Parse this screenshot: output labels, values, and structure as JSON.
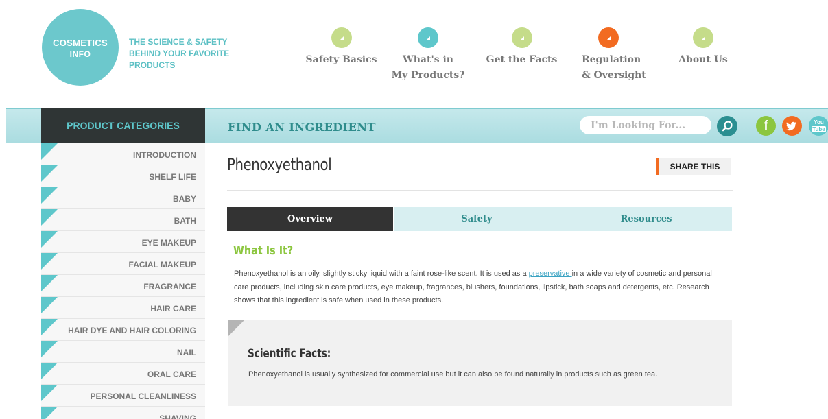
{
  "brand": {
    "logo_line1": "COSMETICS",
    "logo_line2": "INFO",
    "tagline": "THE SCIENCE & SAFETY BEHIND YOUR FAVORITE PRODUCTS",
    "accent": "#6cc8cc"
  },
  "nav": {
    "items": [
      {
        "line1": "Safety Basics",
        "line2": "",
        "color": "#c5dc8a"
      },
      {
        "line1": "What's in",
        "line2": "My Products?",
        "color": "#5ec7cb"
      },
      {
        "line1": "Get the Facts",
        "line2": "",
        "color": "#c5dc8a"
      },
      {
        "line1": "Regulation",
        "line2": "& Oversight",
        "color": "#f26b21"
      },
      {
        "line1": "About Us",
        "line2": "",
        "color": "#c5dc8a"
      }
    ]
  },
  "categories": {
    "header": "PRODUCT CATEGORIES",
    "items": [
      "INTRODUCTION",
      "SHELF LIFE",
      "BABY",
      "BATH",
      "EYE MAKEUP",
      "FACIAL MAKEUP",
      "FRAGRANCE",
      "HAIR CARE",
      "HAIR DYE AND HAIR COLORING",
      "NAIL",
      "ORAL CARE",
      "PERSONAL CLEANLINESS",
      "SHAVING"
    ]
  },
  "finder": {
    "title": "FIND AN INGREDIENT",
    "search_placeholder": "I'm Looking For...",
    "search_icon": "search-icon"
  },
  "social": {
    "icons": [
      "facebook-icon",
      "twitter-icon",
      "youtube-icon"
    ],
    "facebook_label": "f",
    "twitter_label": "t",
    "youtube_label_top": "You",
    "youtube_label_bottom": "Tube",
    "colors": {
      "facebook": "#8cc63f",
      "twitter": "#f26b21",
      "youtube": "#5ec7cb"
    }
  },
  "ingredient": {
    "name": "Phenoxyethanol",
    "share_label": "SHARE THIS",
    "tabs": [
      "Overview",
      "Safety",
      "Resources"
    ],
    "active_tab": "Overview",
    "what_is_heading": "What Is It?",
    "description_before_link": "Phenoxyethanol is an oily, slightly sticky liquid with a faint rose-like scent. It is used as a ",
    "description_link": "preservative ",
    "description_after_link": "in a wide variety of cosmetic and personal care products, including skin care products, eye makeup, fragrances, blushers, foundations, lipstick, bath soaps and detergents, etc. Research shows that this ingredient is safe when used in these products.",
    "facts_heading": "Scientific Facts:",
    "facts_text": "Phenoxyethanol is usually synthesized for commercial use but it can also be found naturally in products such as green tea."
  }
}
